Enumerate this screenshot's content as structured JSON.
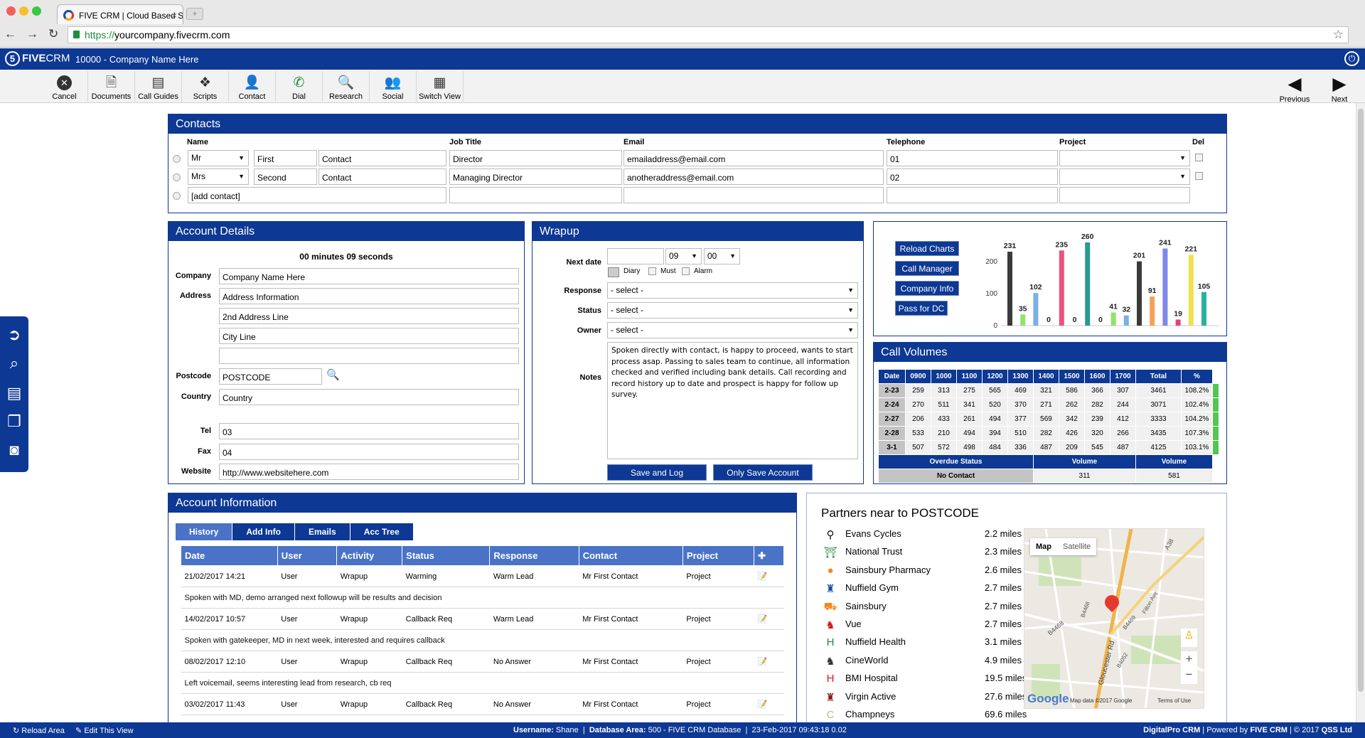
{
  "browser": {
    "tab_title": "FIVE CRM | Cloud Based Sa",
    "url_scheme": "https://",
    "url_rest": "yourcompany.fivecrm.com"
  },
  "app": {
    "logo_five": "5",
    "logo_brand": "FIVE",
    "logo_crm": "CRM",
    "company_line": "10000 - Company Name Here"
  },
  "toolbar": {
    "items": [
      "Cancel",
      "Documents",
      "Call Guides",
      "Scripts",
      "Contact",
      "Dial",
      "Research",
      "Social",
      "Switch View"
    ],
    "previous": "Previous",
    "next": "Next"
  },
  "contacts": {
    "title": "Contacts",
    "headers": {
      "name": "Name",
      "job": "Job Title",
      "email": "Email",
      "tel": "Telephone",
      "project": "Project",
      "del": "Del"
    },
    "rows": [
      {
        "title": "Mr",
        "first": "First",
        "last": "Contact",
        "job": "Director",
        "email": "emailaddress@email.com",
        "tel": "01"
      },
      {
        "title": "Mrs",
        "first": "Second",
        "last": "Contact",
        "job": "Managing Director",
        "email": "anotheraddress@email.com",
        "tel": "02"
      }
    ],
    "add_placeholder": "[add contact]"
  },
  "account": {
    "title": "Account Details",
    "timer": "00 minutes 09 seconds",
    "labels": {
      "company": "Company",
      "address": "Address",
      "postcode": "Postcode",
      "country": "Country",
      "tel": "Tel",
      "fax": "Fax",
      "website": "Website"
    },
    "company": "Company Name Here",
    "address1": "Address Information",
    "address2": "2nd Address Line",
    "address3": "City Line",
    "address4": "",
    "postcode": "POSTCODE",
    "country": "Country",
    "tel": "03",
    "fax": "04",
    "website": "http://www.websitehere.com"
  },
  "wrapup": {
    "title": "Wrapup",
    "labels": {
      "next_date": "Next date",
      "response": "Response",
      "status": "Status",
      "owner": "Owner",
      "notes": "Notes"
    },
    "hour": "09",
    "minute": "00",
    "checks": [
      "Diary",
      "Must",
      "Alarm"
    ],
    "select_placeholder": "- select -",
    "notes": "Spoken directly with contact, is happy to proceed, wants to start process asap. Passing to sales team to continue, all information checked and verified including bank details. Call recording and record history up to date and prospect is happy for follow up survey.",
    "save_log": "Save and Log",
    "save_account": "Only Save Account"
  },
  "chart_panel": {
    "buttons": [
      "Reload Charts",
      "Call Manager",
      "Company Info",
      "Pass for DC"
    ]
  },
  "chart_data": {
    "type": "bar",
    "yticks": [
      "0",
      "100",
      "200"
    ],
    "ylim": [
      0,
      280
    ],
    "values": [
      231,
      35,
      102,
      0,
      235,
      0,
      260,
      0,
      41,
      32,
      201,
      91,
      241,
      19,
      221,
      105
    ],
    "colors": [
      "#3a3a3a",
      "#8fe36e",
      "#7ab0e8",
      "#3a3a3a",
      "#f0507a",
      "#3a3a3a",
      "#2a9a8e",
      "#3a3a3a",
      "#8fe36e",
      "#7ab0e8",
      "#3a3a3a",
      "#f4a15a",
      "#7d88e8",
      "#e8407a",
      "#f0e050",
      "#2ab0a0"
    ]
  },
  "call_volumes": {
    "title": "Call Volumes",
    "headers": [
      "Date",
      "0900",
      "1000",
      "1100",
      "1200",
      "1300",
      "1400",
      "1500",
      "1600",
      "1700",
      "Total",
      "%"
    ],
    "rows": [
      [
        "2-23",
        "259",
        "313",
        "275",
        "565",
        "469",
        "321",
        "586",
        "366",
        "307",
        "3461",
        "108.2%"
      ],
      [
        "2-24",
        "270",
        "511",
        "341",
        "520",
        "370",
        "271",
        "262",
        "282",
        "244",
        "3071",
        "102.4%"
      ],
      [
        "2-27",
        "206",
        "433",
        "261",
        "494",
        "377",
        "569",
        "342",
        "239",
        "412",
        "3333",
        "104.2%"
      ],
      [
        "2-28",
        "533",
        "210",
        "494",
        "394",
        "510",
        "282",
        "426",
        "320",
        "266",
        "3435",
        "107.3%"
      ],
      [
        "3-1",
        "507",
        "572",
        "498",
        "484",
        "336",
        "487",
        "209",
        "545",
        "487",
        "4125",
        "103.1%"
      ]
    ],
    "overdue_headers": [
      "Overdue Status",
      "Volume",
      "Volume"
    ],
    "overdue_row": [
      "No Contact",
      "311",
      "581"
    ]
  },
  "account_info": {
    "title": "Account Information",
    "tabs": [
      "History",
      "Add Info",
      "Emails",
      "Acc Tree"
    ],
    "headers": [
      "Date",
      "User",
      "Activity",
      "Status",
      "Response",
      "Contact",
      "Project"
    ],
    "entries": [
      {
        "date": "21/02/2017 14:21",
        "user": "User",
        "activity": "Wrapup",
        "status": "Warming",
        "response": "Warm Lead",
        "contact": "Mr First Contact",
        "project": "Project",
        "note": "Spoken with MD, demo arranged next followup will be results and decision"
      },
      {
        "date": "14/02/2017 10:57",
        "user": "User",
        "activity": "Wrapup",
        "status": "Callback Req",
        "response": "Warm Lead",
        "contact": "Mr First Contact",
        "project": "Project",
        "note": "Spoken with gatekeeper, MD in next week, interested and requires callback"
      },
      {
        "date": "08/02/2017 12:10",
        "user": "User",
        "activity": "Wrapup",
        "status": "Callback Req",
        "response": "No Answer",
        "contact": "Mr First Contact",
        "project": "Project",
        "note": "Left voicemail, seems interesting lead from research, cb req"
      },
      {
        "date": "03/02/2017 11:43",
        "user": "User",
        "activity": "Wrapup",
        "status": "Callback Req",
        "response": "No Answer",
        "contact": "Mr First Contact",
        "project": "Project",
        "note": ""
      }
    ]
  },
  "partners": {
    "title": "Partners near to POSTCODE",
    "items": [
      {
        "name": "Evans Cycles",
        "dist": "2.2 miles",
        "icon": "bicycle-icon",
        "glyph": "⚲",
        "color": "#111"
      },
      {
        "name": "National Trust",
        "dist": "2.3 miles",
        "icon": "bench-icon",
        "glyph": "⛩",
        "color": "#1a8a3a"
      },
      {
        "name": "Sainsbury Pharmacy",
        "dist": "2.6 miles",
        "icon": "pill-icon",
        "glyph": "●",
        "color": "#f08a1a"
      },
      {
        "name": "Nuffield Gym",
        "dist": "2.7 miles",
        "icon": "weightlifter-icon",
        "glyph": "♜",
        "color": "#1a4fa0"
      },
      {
        "name": "Sainsbury",
        "dist": "2.7 miles",
        "icon": "shopping-cart-icon",
        "glyph": "⛟",
        "color": "#f08a1a"
      },
      {
        "name": "Vue",
        "dist": "2.7 miles",
        "icon": "cinema-icon",
        "glyph": "♞",
        "color": "#d01a1a"
      },
      {
        "name": "Nuffield Health",
        "dist": "3.1 miles",
        "icon": "hospital-h-icon",
        "glyph": "H",
        "color": "#1a8a3a"
      },
      {
        "name": "CineWorld",
        "dist": "4.9 miles",
        "icon": "film-camera-icon",
        "glyph": "♞",
        "color": "#333"
      },
      {
        "name": "BMI Hospital",
        "dist": "19.5 miles",
        "icon": "hospital-h-icon",
        "glyph": "H",
        "color": "#d01a1a"
      },
      {
        "name": "Virgin Active",
        "dist": "27.6 miles",
        "icon": "weightlifter-icon",
        "glyph": "♜",
        "color": "#8a1a1a"
      },
      {
        "name": "Champneys",
        "dist": "69.6 miles",
        "icon": "champneys-c-icon",
        "glyph": "C",
        "color": "#c8b490"
      }
    ]
  },
  "map": {
    "map_tab": "Map",
    "satellite_tab": "Satellite",
    "road_labels": [
      "A38",
      "B4468",
      "Gloucester Rd",
      "B4052",
      "Filton Ave",
      "B4469",
      "B4468"
    ],
    "google": "Google",
    "map_data": "Map data ©2017 Google",
    "terms": "Terms of Use"
  },
  "statusbar": {
    "reload": "Reload Area",
    "edit": "Edit This View",
    "username_label": "Username:",
    "username": "Shane",
    "db_label": "Database Area:",
    "db": "500 - FIVE CRM Database",
    "timestamp": "23-Feb-2017 09:43:18 0.02",
    "product": "DigitalPro CRM",
    "powered": "| Powered by",
    "powered_brand": "FIVE CRM",
    "copyright": "| © 2017",
    "company": "QSS Ltd"
  }
}
